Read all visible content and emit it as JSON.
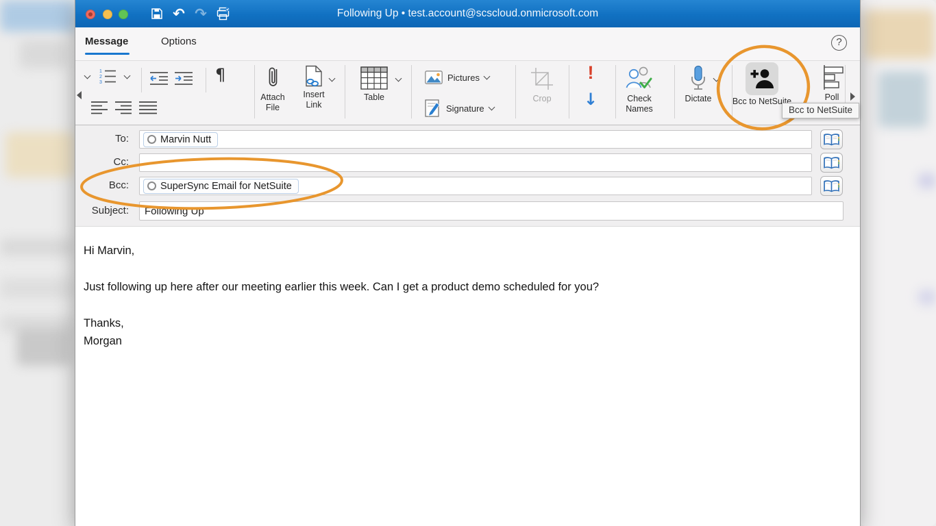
{
  "titlebar": {
    "title": "Following Up • test.account@scscloud.onmicrosoft.com"
  },
  "tabs": {
    "message": "Message",
    "options": "Options"
  },
  "ribbon": {
    "attach_file": "Attach File",
    "insert_link": "Insert Link",
    "table": "Table",
    "pictures": "Pictures",
    "signature": "Signature",
    "crop": "Crop",
    "check_names": "Check Names",
    "dictate": "Dictate",
    "bcc_to_netsuite": "Bcc to NetSuite",
    "poll": "Poll"
  },
  "tooltip": {
    "text": "Bcc to NetSuite"
  },
  "fields": {
    "to": {
      "label": "To:",
      "recipient": "Marvin Nutt"
    },
    "cc": {
      "label": "Cc:"
    },
    "bcc": {
      "label": "Bcc:",
      "recipient": "SuperSync Email for NetSuite"
    },
    "subject": {
      "label": "Subject:",
      "value": "Following Up"
    }
  },
  "body": {
    "text": "Hi Marvin,\n\nJust following up here after our meeting earlier this week. Can I get a product demo scheduled for you?\n\nThanks,\nMorgan"
  },
  "icons": {
    "undo": "↶",
    "redo": "↷",
    "pilcrow": "¶",
    "help": "?",
    "high_importance": "!",
    "low_importance": "↓"
  },
  "colors": {
    "titlebar_top": "#2585d2",
    "titlebar_bottom": "#0d66b5",
    "accent_blue": "#1977cf",
    "annotation_orange": "#e8962e",
    "importance_red": "#d8402a",
    "importance_blue": "#2f7fd4"
  }
}
